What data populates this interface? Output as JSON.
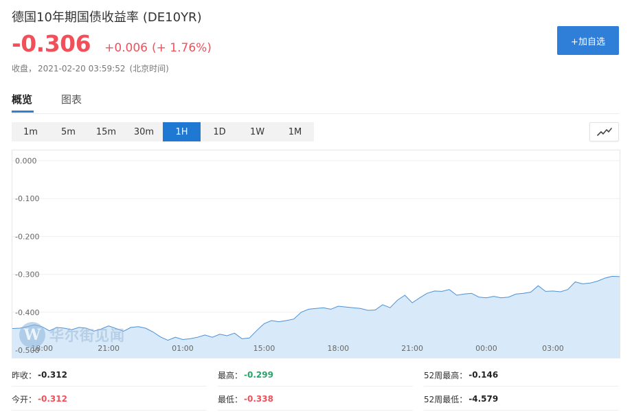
{
  "header": {
    "title": "德国10年期国债收益率",
    "code": "(DE10YR)",
    "price": "-0.306",
    "change": "+0.006",
    "change_pct": "(+ 1.76%)",
    "status_label": "收盘，",
    "timestamp": "2021-02-20 03:59:52",
    "timezone": "(北京时间)",
    "add_button": "+加自选"
  },
  "tabs": [
    {
      "label": "概览",
      "active": true
    },
    {
      "label": "图表",
      "active": false
    }
  ],
  "ranges": [
    {
      "label": "1m",
      "active": false
    },
    {
      "label": "5m",
      "active": false
    },
    {
      "label": "15m",
      "active": false
    },
    {
      "label": "30m",
      "active": false
    },
    {
      "label": "1H",
      "active": true
    },
    {
      "label": "1D",
      "active": false
    },
    {
      "label": "1W",
      "active": false
    },
    {
      "label": "1M",
      "active": false
    }
  ],
  "chart_type_icon": "line-chart-icon",
  "watermark": {
    "logo": "W",
    "text": "华尔街见闻"
  },
  "chart_data": {
    "type": "area",
    "ylim": [
      -0.5,
      0.0
    ],
    "y_ticks": [
      "0.000",
      "-0.100",
      "-0.200",
      "-0.300",
      "-0.400",
      "-0.500"
    ],
    "x_ticks": [
      "18:00",
      "21:00",
      "01:00",
      "15:00",
      "18:00",
      "21:00",
      "00:00",
      "03:00"
    ],
    "x_tick_index": [
      4,
      13,
      23,
      34,
      44,
      54,
      64,
      73
    ],
    "grid": true,
    "colors": {
      "line": "#4a90d6",
      "fill": "#d8eaf9"
    },
    "series": [
      {
        "values": [
          -0.443,
          -0.442,
          -0.438,
          -0.433,
          -0.438,
          -0.449,
          -0.44,
          -0.442,
          -0.446,
          -0.44,
          -0.442,
          -0.45,
          -0.444,
          -0.436,
          -0.443,
          -0.45,
          -0.44,
          -0.438,
          -0.442,
          -0.452,
          -0.465,
          -0.474,
          -0.466,
          -0.472,
          -0.47,
          -0.466,
          -0.46,
          -0.466,
          -0.458,
          -0.462,
          -0.455,
          -0.47,
          -0.468,
          -0.448,
          -0.43,
          -0.422,
          -0.425,
          -0.422,
          -0.418,
          -0.4,
          -0.392,
          -0.39,
          -0.388,
          -0.392,
          -0.384,
          -0.386,
          -0.388,
          -0.39,
          -0.395,
          -0.394,
          -0.38,
          -0.388,
          -0.368,
          -0.355,
          -0.375,
          -0.362,
          -0.35,
          -0.344,
          -0.345,
          -0.34,
          -0.355,
          -0.352,
          -0.35,
          -0.36,
          -0.362,
          -0.358,
          -0.362,
          -0.36,
          -0.352,
          -0.35,
          -0.347,
          -0.33,
          -0.345,
          -0.344,
          -0.346,
          -0.34,
          -0.32,
          -0.325,
          -0.323,
          -0.318,
          -0.31,
          -0.305,
          -0.306
        ]
      }
    ]
  },
  "stats": [
    {
      "label": "昨收：",
      "value": "-0.312",
      "color": "dark"
    },
    {
      "label": "最高：",
      "value": "-0.299",
      "color": "green"
    },
    {
      "label": "52周最高：",
      "value": "-0.146",
      "color": "dark"
    },
    {
      "label": "今开：",
      "value": "-0.312",
      "color": "red"
    },
    {
      "label": "最低：",
      "value": "-0.338",
      "color": "red"
    },
    {
      "label": "52周最低：",
      "value": "-4.579",
      "color": "dark"
    }
  ]
}
